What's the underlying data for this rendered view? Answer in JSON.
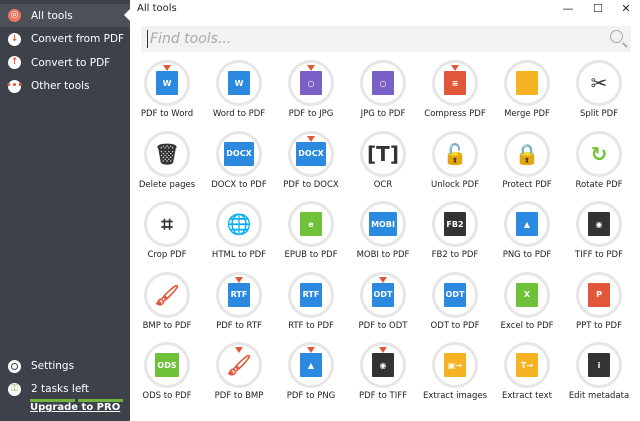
{
  "sidebar": {
    "items": [
      {
        "label": "All tools",
        "icon": "target-icon",
        "glyph": "◎",
        "active": true
      },
      {
        "label": "Convert from PDF",
        "icon": "arrow-down-icon",
        "glyph": "↓",
        "active": false
      },
      {
        "label": "Convert to PDF",
        "icon": "arrow-up-icon",
        "glyph": "↑",
        "active": false
      },
      {
        "label": "Other tools",
        "icon": "more-icon",
        "glyph": "•••",
        "active": false
      }
    ],
    "settings_label": "Settings",
    "tasks_label": "2 tasks left",
    "tasks_progress": {
      "filled_segments": 2,
      "total_segments": 2
    },
    "upgrade_label": "Upgrade to PRO",
    "progress_color": "#6fb43f"
  },
  "header": {
    "title": "All tools",
    "minimize": "—",
    "maximize": "☐",
    "close": "✕"
  },
  "search": {
    "placeholder": "Find tools..."
  },
  "tools": [
    {
      "label": "PDF to Word",
      "icon": "word-icon",
      "color": "#2b8ae0",
      "glyph": "W",
      "arrow": true
    },
    {
      "label": "Word to PDF",
      "icon": "word-icon",
      "color": "#2b8ae0",
      "glyph": "W",
      "arrow": false
    },
    {
      "label": "PDF to JPG",
      "icon": "jpg-icon",
      "color": "#7a5fc7",
      "glyph": "○",
      "arrow": true
    },
    {
      "label": "JPG to PDF",
      "icon": "jpg-icon",
      "color": "#7a5fc7",
      "glyph": "○",
      "arrow": false
    },
    {
      "label": "Compress PDF",
      "icon": "compress-icon",
      "color": "#e0573b",
      "glyph": "≡",
      "arrow": true
    },
    {
      "label": "Merge PDF",
      "icon": "merge-icon",
      "color": "#f5b323",
      "glyph": "",
      "arrow": false
    },
    {
      "label": "Split PDF",
      "icon": "scissors-icon",
      "color": "#333333",
      "glyph": "✂",
      "arrow": false,
      "plain": true
    },
    {
      "label": "Delete pages",
      "icon": "trash-icon",
      "color": "#333333",
      "glyph": "🗑",
      "arrow": false,
      "plain": true
    },
    {
      "label": "DOCX to PDF",
      "icon": "docx-icon",
      "color": "#2b8ae0",
      "glyph": "DOCX",
      "arrow": false
    },
    {
      "label": "PDF to DOCX",
      "icon": "docx-icon",
      "color": "#2b8ae0",
      "glyph": "DOCX",
      "arrow": true
    },
    {
      "label": "OCR",
      "icon": "ocr-icon",
      "color": "#333333",
      "glyph": "[T]",
      "arrow": false,
      "plain": true
    },
    {
      "label": "Unlock PDF",
      "icon": "unlock-icon",
      "color": "#333333",
      "glyph": "🔓",
      "arrow": false,
      "plain": true
    },
    {
      "label": "Protect PDF",
      "icon": "lock-icon",
      "color": "#333333",
      "glyph": "🔒",
      "arrow": false,
      "plain": true
    },
    {
      "label": "Rotate PDF",
      "icon": "rotate-icon",
      "color": "#6fc13a",
      "glyph": "↻",
      "arrow": false,
      "plain": true
    },
    {
      "label": "Crop PDF",
      "icon": "crop-icon",
      "color": "#333333",
      "glyph": "⌗",
      "arrow": false,
      "plain": true
    },
    {
      "label": "HTML to PDF",
      "icon": "globe-icon",
      "color": "#2b8ae0",
      "glyph": "🌐",
      "arrow": false,
      "plain": true
    },
    {
      "label": "EPUB to PDF",
      "icon": "epub-icon",
      "color": "#6fc13a",
      "glyph": "e",
      "arrow": false
    },
    {
      "label": "MOBI to PDF",
      "icon": "mobi-icon",
      "color": "#2b8ae0",
      "glyph": "MOBI",
      "arrow": false
    },
    {
      "label": "FB2 to PDF",
      "icon": "fb2-icon",
      "color": "#333333",
      "glyph": "FB2",
      "arrow": false
    },
    {
      "label": "PNG to PDF",
      "icon": "image-icon",
      "color": "#2b8ae0",
      "glyph": "▲",
      "arrow": false
    },
    {
      "label": "TIFF to PDF",
      "icon": "camera-icon",
      "color": "#333333",
      "glyph": "◉",
      "arrow": false
    },
    {
      "label": "BMP to PDF",
      "icon": "brush-icon",
      "color": "#e0573b",
      "glyph": "🖌",
      "arrow": false,
      "plain": true
    },
    {
      "label": "PDF to RTF",
      "icon": "rtf-icon",
      "color": "#2b8ae0",
      "glyph": "RTF",
      "arrow": true
    },
    {
      "label": "RTF to PDF",
      "icon": "rtf-icon",
      "color": "#2b8ae0",
      "glyph": "RTF",
      "arrow": false
    },
    {
      "label": "PDF to ODT",
      "icon": "odt-icon",
      "color": "#2b8ae0",
      "glyph": "ODT",
      "arrow": true
    },
    {
      "label": "ODT to PDF",
      "icon": "odt-icon",
      "color": "#2b8ae0",
      "glyph": "ODT",
      "arrow": false
    },
    {
      "label": "Excel to PDF",
      "icon": "excel-icon",
      "color": "#6fc13a",
      "glyph": "X",
      "arrow": false
    },
    {
      "label": "PPT to PDF",
      "icon": "ppt-icon",
      "color": "#e0573b",
      "glyph": "P",
      "arrow": false
    },
    {
      "label": "ODS to PDF",
      "icon": "ods-icon",
      "color": "#6fc13a",
      "glyph": "ODS",
      "arrow": false
    },
    {
      "label": "PDF to BMP",
      "icon": "brush-icon",
      "color": "#e0573b",
      "glyph": "🖌",
      "arrow": true,
      "plain": true
    },
    {
      "label": "PDF to PNG",
      "icon": "image-icon",
      "color": "#2b8ae0",
      "glyph": "▲",
      "arrow": true
    },
    {
      "label": "PDF to TIFF",
      "icon": "camera-icon",
      "color": "#333333",
      "glyph": "◉",
      "arrow": true
    },
    {
      "label": "Extract images",
      "icon": "extract-images-icon",
      "color": "#f5b323",
      "glyph": "▣→",
      "arrow": false
    },
    {
      "label": "Extract text",
      "icon": "extract-text-icon",
      "color": "#f5b323",
      "glyph": "T→",
      "arrow": false
    },
    {
      "label": "Edit metadata",
      "icon": "info-icon",
      "color": "#333333",
      "glyph": "i",
      "arrow": false
    }
  ]
}
